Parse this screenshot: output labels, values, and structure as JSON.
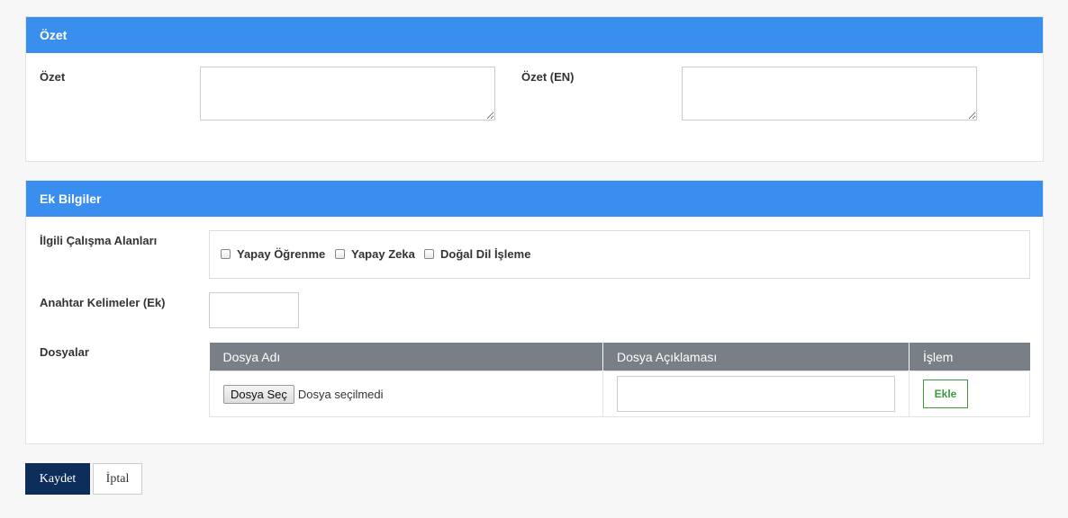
{
  "summary_section": {
    "title": "Özet",
    "summary_label": "Özet",
    "summary_value": "",
    "summary_en_label": "Özet (EN)",
    "summary_en_value": ""
  },
  "extra_section": {
    "title": "Ek Bilgiler",
    "areas_label": "İlgili Çalışma Alanları",
    "areas": [
      {
        "label": "Yapay Öğrenme",
        "checked": false
      },
      {
        "label": "Yapay Zeka",
        "checked": false
      },
      {
        "label": "Doğal Dil İşleme",
        "checked": false
      }
    ],
    "keywords_label": "Anahtar Kelimeler (Ek)",
    "keywords_value": "",
    "files_label": "Dosyalar",
    "files_table": {
      "headers": [
        "Dosya Adı",
        "Dosya Açıklaması",
        "İşlem"
      ],
      "choose_file_button": "Dosya Seç",
      "no_file_text": "Dosya seçilmedi",
      "description_value": "",
      "add_button": "Ekle"
    }
  },
  "actions": {
    "save": "Kaydet",
    "cancel": "İptal"
  },
  "colors": {
    "header_blue": "#3a8eed",
    "table_header_gray": "#787f86",
    "save_navy": "#0d2d5b",
    "add_green": "#3c9a3c"
  }
}
